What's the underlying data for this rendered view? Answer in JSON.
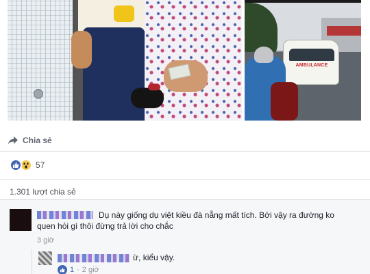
{
  "post": {
    "photos": [
      {
        "name": "main-photo"
      },
      {
        "name": "side-photo",
        "sign_text": "AMBULANCE"
      }
    ],
    "share_label": "Chia sẻ",
    "reactions": {
      "icons": [
        "like-icon",
        "wow-icon"
      ],
      "count": "57"
    },
    "shares_count": "1.301 lượt chia sẻ"
  },
  "comments": [
    {
      "text": "Dụ này giống dụ việt kiều đà nẵng mất tích. Bởi vậy ra đường ko quen hỏi gì thôi đừng trả lời cho chắc",
      "time": "3 giờ",
      "replies": [
        {
          "text": "ừ, kiểu vậy.",
          "likes": "1",
          "separator": "·",
          "time": "2 giờ"
        }
      ]
    }
  ],
  "colors": {
    "facebook_blue": "#4267b2",
    "meta_gray": "#90949c",
    "divider": "#dddfe2"
  }
}
